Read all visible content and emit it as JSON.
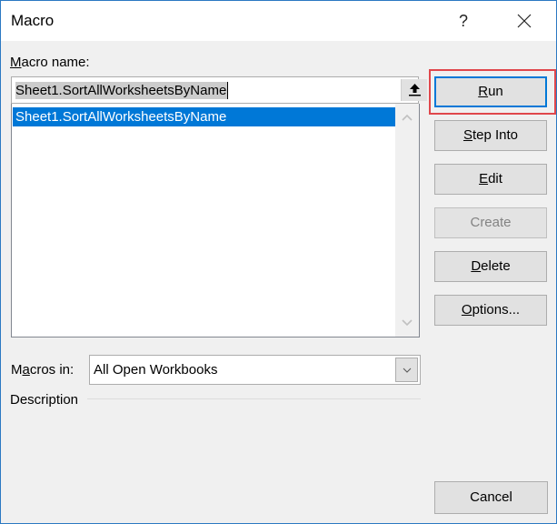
{
  "window": {
    "title": "Macro",
    "help_label": "?",
    "close_icon": "close-icon"
  },
  "macro_name": {
    "label_prefix": "",
    "label_accel": "M",
    "label_rest": "acro name:",
    "value": "Sheet1.SortAllWorksheetsByName",
    "upload_icon": "arrow-up-icon"
  },
  "macro_list": {
    "items": [
      {
        "label": "Sheet1.SortAllWorksheetsByName",
        "selected": true
      }
    ]
  },
  "macros_in": {
    "label_prefix": "M",
    "label_accel": "a",
    "label_rest": "cros in:",
    "selected": "All Open Workbooks"
  },
  "description": {
    "label": "Description"
  },
  "buttons": {
    "run": {
      "accel": "R",
      "rest": "un"
    },
    "step_into": {
      "accel": "S",
      "rest": "tep Into"
    },
    "edit": {
      "accel": "E",
      "rest": "dit"
    },
    "create": {
      "label": "Create",
      "disabled": true
    },
    "delete": {
      "accel": "D",
      "rest": "elete"
    },
    "options": {
      "accel": "O",
      "rest": "ptions..."
    },
    "cancel": {
      "label": "Cancel"
    }
  },
  "colors": {
    "selection": "#0078d7",
    "highlight_annotation": "#e0474c",
    "window_border": "#2b79c2"
  }
}
